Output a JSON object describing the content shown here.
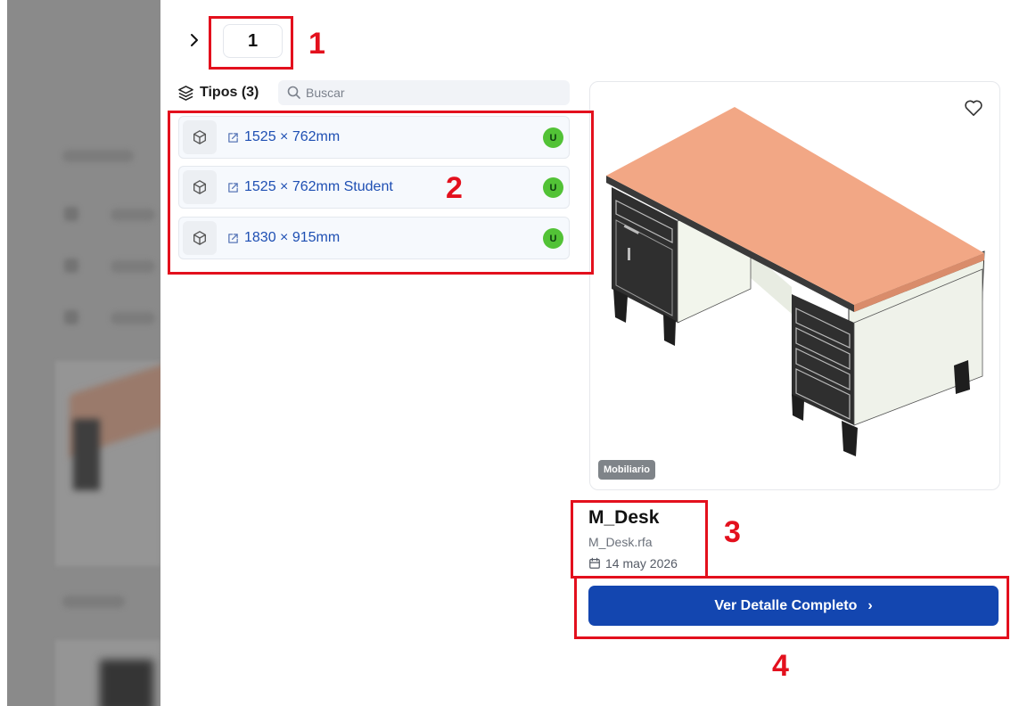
{
  "stepper": {
    "value": "1"
  },
  "types": {
    "label": "Tipos (3)",
    "search_placeholder": "Buscar",
    "items": [
      {
        "label": "1525 × 762mm",
        "badge": "U"
      },
      {
        "label": "1525 × 762mm Student",
        "badge": "U"
      },
      {
        "label": "1830 × 915mm",
        "badge": "U"
      }
    ]
  },
  "preview": {
    "category": "Mobiliario"
  },
  "detail": {
    "title": "M_Desk",
    "file": "M_Desk.rfa",
    "date": "14 may 2026"
  },
  "cta": {
    "label": "Ver Detalle Completo",
    "arrow": "›"
  },
  "annotations": [
    "1",
    "2",
    "3",
    "4"
  ],
  "colors": {
    "accent": "#1346b0",
    "link": "#1e4fb3",
    "badge": "#52c236",
    "annotation": "#e3101d",
    "desk_top": "#f2a785"
  }
}
